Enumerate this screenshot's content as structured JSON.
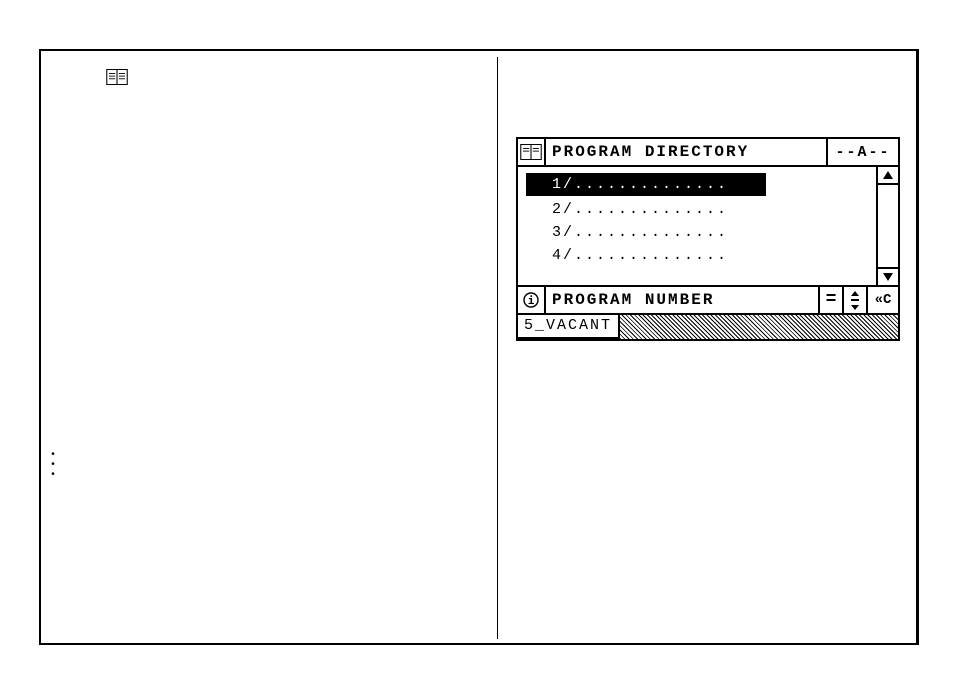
{
  "panel": {
    "title": "PROGRAM DIRECTORY",
    "mode": "--A--",
    "items": [
      {
        "label": "1/..............",
        "selected": true
      },
      {
        "label": "2/..............",
        "selected": false
      },
      {
        "label": "3/..............",
        "selected": false
      },
      {
        "label": "4/..............",
        "selected": false
      }
    ],
    "input_label": "PROGRAM NUMBER",
    "equals": "=",
    "clear": "«C",
    "status": "5_VACANT"
  },
  "icons": {
    "page_book": "book-icon",
    "panel_book": "book-icon",
    "help": "help-icon",
    "scroll_up": "▲",
    "scroll_down": "▼"
  }
}
